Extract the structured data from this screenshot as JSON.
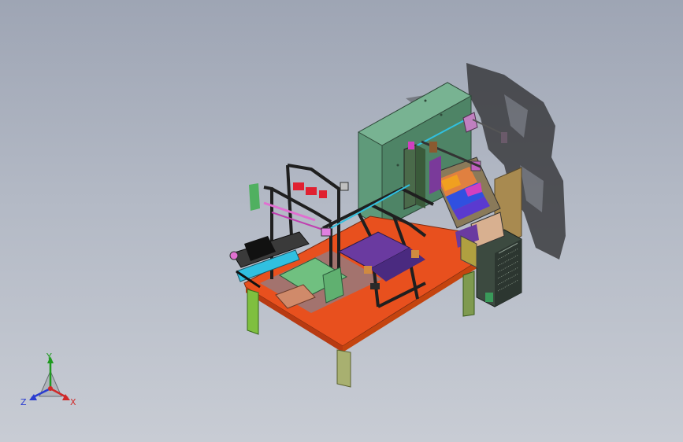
{
  "viewport": {
    "background_top": "#9ea5b4",
    "background_bottom": "#c8ccd4"
  },
  "model": {
    "description_icon": "cad-machine-model",
    "colors": {
      "table_top": "#e8501e",
      "table_legs": "#7fbf3f",
      "cabinet": "#5f9a7a",
      "frame": "#2a2a2a",
      "accent_magenta": "#d040c0",
      "accent_blue": "#3050e0",
      "accent_cyan": "#30c0e0",
      "plate_green": "#70c080",
      "plate_purple": "#6a3aa0",
      "panel_brown": "#a88a50",
      "grille": "#3c4a40",
      "shadow": "#2a2a2a"
    }
  },
  "triad": {
    "icon": "coordinate-triad-icon",
    "x_label": "X",
    "y_label": "Y",
    "z_label": "Z",
    "x_color": "#d02a2a",
    "y_color": "#1f9a1f",
    "z_color": "#2a3cd0"
  }
}
